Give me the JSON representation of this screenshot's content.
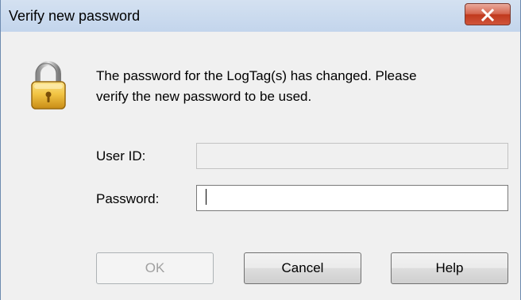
{
  "window": {
    "title": "Verify new password",
    "close_glyph": "✕"
  },
  "message": {
    "line1": "The password for the LogTag(s) has changed. Please",
    "line2": "verify the new password to be used."
  },
  "form": {
    "user_id_label": "User ID:",
    "user_id_value": "",
    "password_label": "Password:",
    "password_value": ""
  },
  "buttons": {
    "ok": "OK",
    "cancel": "Cancel",
    "help": "Help"
  },
  "icons": {
    "lock": "padlock-icon",
    "close": "close-icon"
  },
  "colors": {
    "close_red": "#c0391d",
    "lock_gold": "#e0b23a"
  }
}
